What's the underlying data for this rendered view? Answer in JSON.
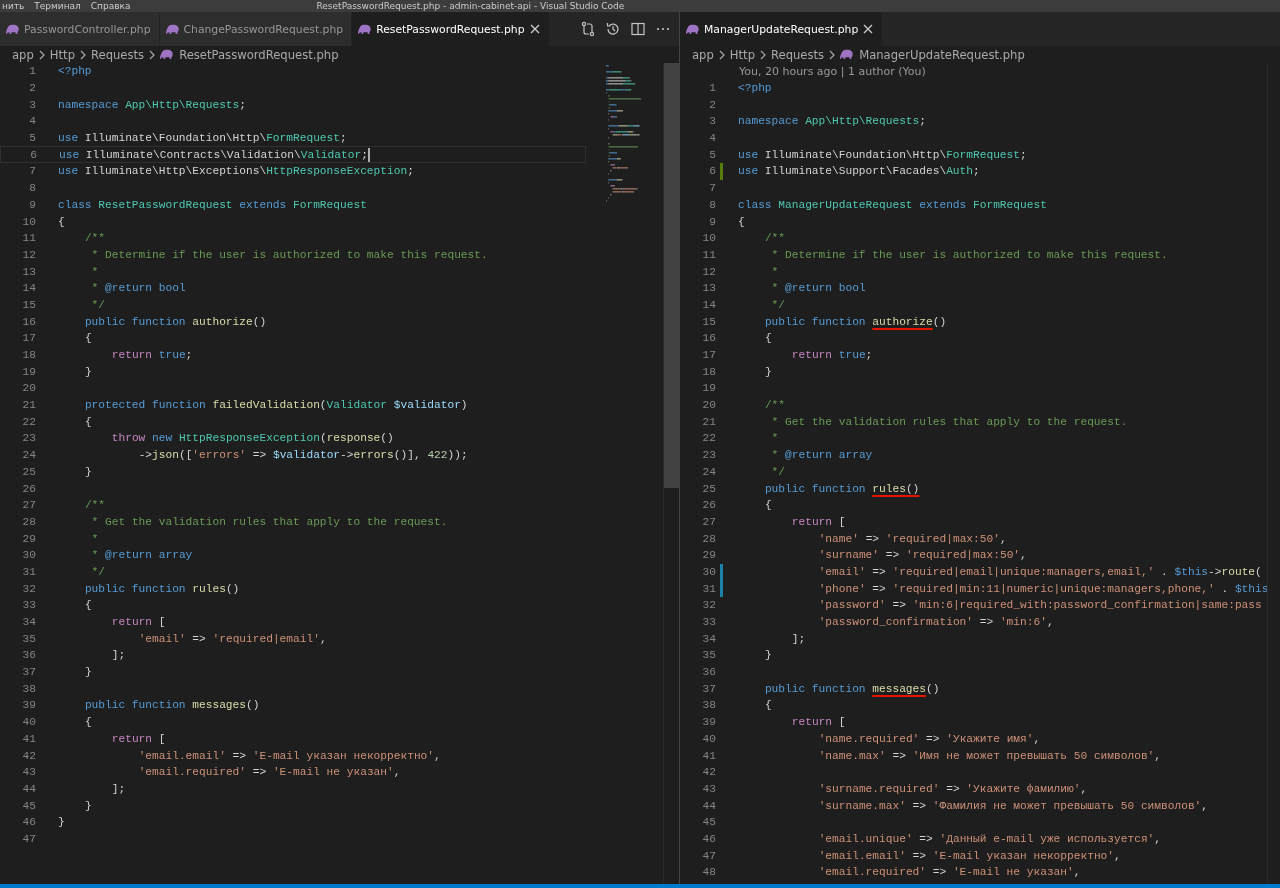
{
  "title_bar": {
    "menu": [
      "нить",
      "Терминал",
      "Справка"
    ],
    "title": "ResetPasswordRequest.php - admin-cabinet-api - Visual Studio Code"
  },
  "editors": [
    {
      "toolbar": true,
      "minimap": true,
      "tabs": [
        {
          "label": "PasswordController.php",
          "selected": false
        },
        {
          "label": "ChangePasswordRequest.php",
          "selected": false
        },
        {
          "label": "ResetPasswordRequest.php",
          "selected": true
        }
      ],
      "breadcrumbs": [
        "app",
        "Http",
        "Requests",
        "ResetPasswordRequest.php"
      ],
      "lines": [
        {
          "n": "1",
          "tokens": [
            {
              "kind": "kw",
              "text": "<?php"
            }
          ]
        },
        {
          "n": "2"
        },
        {
          "n": "3",
          "tokens": [
            {
              "kind": "kw",
              "text": "namespace "
            },
            {
              "kind": "cls",
              "text": "App\\Http\\Requests"
            },
            {
              "kind": "p",
              "text": ";"
            }
          ]
        },
        {
          "n": "4"
        },
        {
          "n": "5",
          "tokens": [
            {
              "kind": "kw",
              "text": "use "
            },
            {
              "kind": "p",
              "text": "Illuminate\\Foundation\\Http\\"
            },
            {
              "kind": "cls",
              "text": "FormRequest"
            },
            {
              "kind": "p",
              "text": ";"
            }
          ]
        },
        {
          "n": "6",
          "current": true,
          "tokens": [
            {
              "kind": "kw",
              "text": "use "
            },
            {
              "kind": "p",
              "text": "Illuminate\\Contracts\\Validation\\"
            },
            {
              "kind": "cls",
              "text": "Validator"
            },
            {
              "kind": "p",
              "text": ";"
            }
          ]
        },
        {
          "n": "7",
          "tokens": [
            {
              "kind": "kw",
              "text": "use "
            },
            {
              "kind": "p",
              "text": "Illuminate\\Http\\Exceptions\\"
            },
            {
              "kind": "cls",
              "text": "HttpResponseException"
            },
            {
              "kind": "p",
              "text": ";"
            }
          ]
        },
        {
          "n": "8"
        },
        {
          "n": "9",
          "tokens": [
            {
              "kind": "kw",
              "text": "class "
            },
            {
              "kind": "cls",
              "text": "ResetPasswordRequest "
            },
            {
              "kind": "kw",
              "text": "extends "
            },
            {
              "kind": "cls",
              "text": "FormRequest"
            }
          ]
        },
        {
          "n": "10",
          "tokens": [
            {
              "kind": "p",
              "text": "{"
            }
          ]
        },
        {
          "n": "11",
          "tokens": [
            {
              "kind": "cm",
              "text": "    /**"
            }
          ]
        },
        {
          "n": "12",
          "tokens": [
            {
              "kind": "cm",
              "text": "     * Determine if the user is authorized to make this request."
            }
          ]
        },
        {
          "n": "13",
          "tokens": [
            {
              "kind": "cm",
              "text": "     *"
            }
          ]
        },
        {
          "n": "14",
          "tokens": [
            {
              "kind": "cm",
              "text": "     * "
            },
            {
              "kind": "doc",
              "text": "@return bool"
            }
          ]
        },
        {
          "n": "15",
          "tokens": [
            {
              "kind": "cm",
              "text": "     */"
            }
          ]
        },
        {
          "n": "16",
          "tokens": [
            {
              "kind": "kw",
              "text": "    public function "
            },
            {
              "kind": "fn",
              "text": "authorize"
            },
            {
              "kind": "p",
              "text": "()"
            }
          ]
        },
        {
          "n": "17",
          "tokens": [
            {
              "kind": "p",
              "text": "    {"
            }
          ]
        },
        {
          "n": "18",
          "tokens": [
            {
              "kind": "ctl",
              "text": "        return "
            },
            {
              "kind": "kw",
              "text": "true"
            },
            {
              "kind": "p",
              "text": ";"
            }
          ]
        },
        {
          "n": "19",
          "tokens": [
            {
              "kind": "p",
              "text": "    }"
            }
          ]
        },
        {
          "n": "20"
        },
        {
          "n": "21",
          "tokens": [
            {
              "kind": "kw",
              "text": "    protected function "
            },
            {
              "kind": "fn",
              "text": "failedValidation"
            },
            {
              "kind": "p",
              "text": "("
            },
            {
              "kind": "cls",
              "text": "Validator "
            },
            {
              "kind": "var",
              "text": "$validator"
            },
            {
              "kind": "p",
              "text": ")"
            }
          ]
        },
        {
          "n": "22",
          "tokens": [
            {
              "kind": "p",
              "text": "    {"
            }
          ]
        },
        {
          "n": "23",
          "tokens": [
            {
              "kind": "ctl",
              "text": "        throw "
            },
            {
              "kind": "kw",
              "text": "new "
            },
            {
              "kind": "cls",
              "text": "HttpResponseException"
            },
            {
              "kind": "p",
              "text": "("
            },
            {
              "kind": "fn",
              "text": "response"
            },
            {
              "kind": "p",
              "text": "()"
            }
          ]
        },
        {
          "n": "24",
          "tokens": [
            {
              "kind": "p",
              "text": "            ->"
            },
            {
              "kind": "fn",
              "text": "json"
            },
            {
              "kind": "p",
              "text": "(["
            },
            {
              "kind": "str",
              "text": "'errors'"
            },
            {
              "kind": "p",
              "text": " => "
            },
            {
              "kind": "var",
              "text": "$validator"
            },
            {
              "kind": "p",
              "text": "->"
            },
            {
              "kind": "fn",
              "text": "errors"
            },
            {
              "kind": "p",
              "text": "()], "
            },
            {
              "kind": "num",
              "text": "422"
            },
            {
              "kind": "p",
              "text": "));"
            }
          ]
        },
        {
          "n": "25",
          "tokens": [
            {
              "kind": "p",
              "text": "    }"
            }
          ]
        },
        {
          "n": "26"
        },
        {
          "n": "27",
          "tokens": [
            {
              "kind": "cm",
              "text": "    /**"
            }
          ]
        },
        {
          "n": "28",
          "tokens": [
            {
              "kind": "cm",
              "text": "     * Get the validation rules that apply to the request."
            }
          ]
        },
        {
          "n": "29",
          "tokens": [
            {
              "kind": "cm",
              "text": "     *"
            }
          ]
        },
        {
          "n": "30",
          "tokens": [
            {
              "kind": "cm",
              "text": "     * "
            },
            {
              "kind": "doc",
              "text": "@return array"
            }
          ]
        },
        {
          "n": "31",
          "tokens": [
            {
              "kind": "cm",
              "text": "     */"
            }
          ]
        },
        {
          "n": "32",
          "tokens": [
            {
              "kind": "kw",
              "text": "    public function "
            },
            {
              "kind": "fn",
              "text": "rules"
            },
            {
              "kind": "p",
              "text": "()"
            }
          ]
        },
        {
          "n": "33",
          "tokens": [
            {
              "kind": "p",
              "text": "    {"
            }
          ]
        },
        {
          "n": "34",
          "tokens": [
            {
              "kind": "ctl",
              "text": "        return "
            },
            {
              "kind": "p",
              "text": "["
            }
          ]
        },
        {
          "n": "35",
          "tokens": [
            {
              "kind": "str",
              "text": "            'email'"
            },
            {
              "kind": "p",
              "text": " => "
            },
            {
              "kind": "str",
              "text": "'required|email'"
            },
            {
              "kind": "p",
              "text": ","
            }
          ]
        },
        {
          "n": "36",
          "tokens": [
            {
              "kind": "p",
              "text": "        ];"
            }
          ]
        },
        {
          "n": "37",
          "tokens": [
            {
              "kind": "p",
              "text": "    }"
            }
          ]
        },
        {
          "n": "38"
        },
        {
          "n": "39",
          "tokens": [
            {
              "kind": "kw",
              "text": "    public function "
            },
            {
              "kind": "fn",
              "text": "messages"
            },
            {
              "kind": "p",
              "text": "()"
            }
          ]
        },
        {
          "n": "40",
          "tokens": [
            {
              "kind": "p",
              "text": "    {"
            }
          ]
        },
        {
          "n": "41",
          "tokens": [
            {
              "kind": "ctl",
              "text": "        return "
            },
            {
              "kind": "p",
              "text": "["
            }
          ]
        },
        {
          "n": "42",
          "tokens": [
            {
              "kind": "str",
              "text": "            'email.email'"
            },
            {
              "kind": "p",
              "text": " => "
            },
            {
              "kind": "str",
              "text": "'E-mail указан некорректно'"
            },
            {
              "kind": "p",
              "text": ","
            }
          ]
        },
        {
          "n": "43",
          "tokens": [
            {
              "kind": "str",
              "text": "            'email.required'"
            },
            {
              "kind": "p",
              "text": " => "
            },
            {
              "kind": "str",
              "text": "'E-mail не указан'"
            },
            {
              "kind": "p",
              "text": ","
            }
          ]
        },
        {
          "n": "44",
          "tokens": [
            {
              "kind": "p",
              "text": "        ];"
            }
          ]
        },
        {
          "n": "45",
          "tokens": [
            {
              "kind": "p",
              "text": "    }"
            }
          ]
        },
        {
          "n": "46",
          "tokens": [
            {
              "kind": "p",
              "text": "}"
            }
          ]
        },
        {
          "n": "47"
        }
      ]
    },
    {
      "toolbar": false,
      "minimap": false,
      "tabs": [
        {
          "label": "ManagerUpdateRequest.php",
          "selected": true
        }
      ],
      "breadcrumbs": [
        "app",
        "Http",
        "Requests",
        "ManagerUpdateRequest.php"
      ],
      "codelens": "You, 20 hours ago | 1 author (You)",
      "lines": [
        {
          "n": "1",
          "tokens": [
            {
              "kind": "kw",
              "text": "<?php"
            }
          ]
        },
        {
          "n": "2"
        },
        {
          "n": "3",
          "tokens": [
            {
              "kind": "kw",
              "text": "namespace "
            },
            {
              "kind": "cls",
              "text": "App\\Http\\Requests"
            },
            {
              "kind": "p",
              "text": ";"
            }
          ]
        },
        {
          "n": "4"
        },
        {
          "n": "5",
          "tokens": [
            {
              "kind": "kw",
              "text": "use "
            },
            {
              "kind": "p",
              "text": "Illuminate\\Foundation\\Http\\"
            },
            {
              "kind": "cls",
              "text": "FormRequest"
            },
            {
              "kind": "p",
              "text": ";"
            }
          ]
        },
        {
          "n": "6",
          "color": "#587c0c",
          "tokens": [
            {
              "kind": "kw",
              "text": "use "
            },
            {
              "kind": "p",
              "text": "Illuminate\\Support\\Facades\\"
            },
            {
              "kind": "cls",
              "text": "Auth"
            },
            {
              "kind": "p",
              "text": ";"
            }
          ]
        },
        {
          "n": "7"
        },
        {
          "n": "8",
          "tokens": [
            {
              "kind": "kw",
              "text": "class "
            },
            {
              "kind": "cls",
              "text": "ManagerUpdateRequest "
            },
            {
              "kind": "kw",
              "text": "extends "
            },
            {
              "kind": "cls",
              "text": "FormRequest"
            }
          ]
        },
        {
          "n": "9",
          "tokens": [
            {
              "kind": "p",
              "text": "{"
            }
          ]
        },
        {
          "n": "10",
          "tokens": [
            {
              "kind": "cm",
              "text": "    /**"
            }
          ]
        },
        {
          "n": "11",
          "tokens": [
            {
              "kind": "cm",
              "text": "     * Determine if the user is authorized to make this request."
            }
          ]
        },
        {
          "n": "12",
          "tokens": [
            {
              "kind": "cm",
              "text": "     *"
            }
          ]
        },
        {
          "n": "13",
          "tokens": [
            {
              "kind": "cm",
              "text": "     * "
            },
            {
              "kind": "doc",
              "text": "@return bool"
            }
          ]
        },
        {
          "n": "14",
          "tokens": [
            {
              "kind": "cm",
              "text": "     */"
            }
          ]
        },
        {
          "n": "15",
          "tokens": [
            {
              "kind": "kw",
              "text": "    public function "
            },
            {
              "kind": "fn",
              "text": "authorize",
              "underline": true
            },
            {
              "kind": "p",
              "text": "()"
            }
          ]
        },
        {
          "n": "16",
          "tokens": [
            {
              "kind": "p",
              "text": "    {"
            }
          ]
        },
        {
          "n": "17",
          "tokens": [
            {
              "kind": "ctl",
              "text": "        return "
            },
            {
              "kind": "kw",
              "text": "true"
            },
            {
              "kind": "p",
              "text": ";"
            }
          ]
        },
        {
          "n": "18",
          "tokens": [
            {
              "kind": "p",
              "text": "    }"
            }
          ]
        },
        {
          "n": "19"
        },
        {
          "n": "20",
          "tokens": [
            {
              "kind": "cm",
              "text": "    /**"
            }
          ]
        },
        {
          "n": "21",
          "tokens": [
            {
              "kind": "cm",
              "text": "     * Get the validation rules that apply to the request."
            }
          ]
        },
        {
          "n": "22",
          "tokens": [
            {
              "kind": "cm",
              "text": "     *"
            }
          ]
        },
        {
          "n": "23",
          "tokens": [
            {
              "kind": "cm",
              "text": "     * "
            },
            {
              "kind": "doc",
              "text": "@return array"
            }
          ]
        },
        {
          "n": "24",
          "tokens": [
            {
              "kind": "cm",
              "text": "     */"
            }
          ]
        },
        {
          "n": "25",
          "tokens": [
            {
              "kind": "kw",
              "text": "    public function "
            },
            {
              "kind": "fn",
              "text": "rules",
              "underline": true
            },
            {
              "kind": "p",
              "text": "()",
              "underline": true
            }
          ]
        },
        {
          "n": "26",
          "tokens": [
            {
              "kind": "p",
              "text": "    {"
            }
          ]
        },
        {
          "n": "27",
          "tokens": [
            {
              "kind": "ctl",
              "text": "        return "
            },
            {
              "kind": "p",
              "text": "["
            }
          ]
        },
        {
          "n": "28",
          "tokens": [
            {
              "kind": "str",
              "text": "            'name'"
            },
            {
              "kind": "p",
              "text": " => "
            },
            {
              "kind": "str",
              "text": "'required|max:50'"
            },
            {
              "kind": "p",
              "text": ","
            }
          ]
        },
        {
          "n": "29",
          "tokens": [
            {
              "kind": "str",
              "text": "            'surname'"
            },
            {
              "kind": "p",
              "text": " => "
            },
            {
              "kind": "str",
              "text": "'required|max:50'"
            },
            {
              "kind": "p",
              "text": ","
            }
          ]
        },
        {
          "n": "30",
          "color": "#1b81a8",
          "tokens": [
            {
              "kind": "str",
              "text": "            'email'"
            },
            {
              "kind": "p",
              "text": " => "
            },
            {
              "kind": "str",
              "text": "'required|email|unique:managers,email,'"
            },
            {
              "kind": "p",
              "text": " . "
            },
            {
              "kind": "kw",
              "text": "$this"
            },
            {
              "kind": "p",
              "text": "->"
            },
            {
              "kind": "fn",
              "text": "route"
            },
            {
              "kind": "p",
              "text": "("
            }
          ]
        },
        {
          "n": "31",
          "color": "#1b81a8",
          "tokens": [
            {
              "kind": "str",
              "text": "            'phone'"
            },
            {
              "kind": "p",
              "text": " => "
            },
            {
              "kind": "str",
              "text": "'required|min:11|numeric|unique:managers,phone,'"
            },
            {
              "kind": "p",
              "text": " . "
            },
            {
              "kind": "kw",
              "text": "$this"
            }
          ]
        },
        {
          "n": "32",
          "tokens": [
            {
              "kind": "str",
              "text": "            'password'"
            },
            {
              "kind": "p",
              "text": " => "
            },
            {
              "kind": "str",
              "text": "'min:6|required_with:password_confirmation|same:pass"
            }
          ]
        },
        {
          "n": "33",
          "tokens": [
            {
              "kind": "str",
              "text": "            'password_confirmation'"
            },
            {
              "kind": "p",
              "text": " => "
            },
            {
              "kind": "str",
              "text": "'min:6'"
            },
            {
              "kind": "p",
              "text": ","
            }
          ]
        },
        {
          "n": "34",
          "tokens": [
            {
              "kind": "p",
              "text": "        ];"
            }
          ]
        },
        {
          "n": "35",
          "tokens": [
            {
              "kind": "p",
              "text": "    }"
            }
          ]
        },
        {
          "n": "36"
        },
        {
          "n": "37",
          "tokens": [
            {
              "kind": "kw",
              "text": "    public function "
            },
            {
              "kind": "fn",
              "text": "messages",
              "underline": true
            },
            {
              "kind": "p",
              "text": "()"
            }
          ]
        },
        {
          "n": "38",
          "tokens": [
            {
              "kind": "p",
              "text": "    {"
            }
          ]
        },
        {
          "n": "39",
          "tokens": [
            {
              "kind": "ctl",
              "text": "        return "
            },
            {
              "kind": "p",
              "text": "["
            }
          ]
        },
        {
          "n": "40",
          "tokens": [
            {
              "kind": "str",
              "text": "            'name.required'"
            },
            {
              "kind": "p",
              "text": " => "
            },
            {
              "kind": "str",
              "text": "'Укажите имя'"
            },
            {
              "kind": "p",
              "text": ","
            }
          ]
        },
        {
          "n": "41",
          "tokens": [
            {
              "kind": "str",
              "text": "            'name.max'"
            },
            {
              "kind": "p",
              "text": " => "
            },
            {
              "kind": "str",
              "text": "'Имя не может превышать 50 символов'"
            },
            {
              "kind": "p",
              "text": ","
            }
          ]
        },
        {
          "n": "42"
        },
        {
          "n": "43",
          "tokens": [
            {
              "kind": "str",
              "text": "            'surname.required'"
            },
            {
              "kind": "p",
              "text": " => "
            },
            {
              "kind": "str",
              "text": "'Укажите фамилию'"
            },
            {
              "kind": "p",
              "text": ","
            }
          ]
        },
        {
          "n": "44",
          "tokens": [
            {
              "kind": "str",
              "text": "            'surname.max'"
            },
            {
              "kind": "p",
              "text": " => "
            },
            {
              "kind": "str",
              "text": "'Фамилия не может превышать 50 символов'"
            },
            {
              "kind": "p",
              "text": ","
            }
          ]
        },
        {
          "n": "45"
        },
        {
          "n": "46",
          "tokens": [
            {
              "kind": "str",
              "text": "            'email.unique'"
            },
            {
              "kind": "p",
              "text": " => "
            },
            {
              "kind": "str",
              "text": "'Данный e-mail уже используется'"
            },
            {
              "kind": "p",
              "text": ","
            }
          ]
        },
        {
          "n": "47",
          "tokens": [
            {
              "kind": "str",
              "text": "            'email.email'"
            },
            {
              "kind": "p",
              "text": " => "
            },
            {
              "kind": "str",
              "text": "'E-mail указан некорректно'"
            },
            {
              "kind": "p",
              "text": ","
            }
          ]
        },
        {
          "n": "48",
          "tokens": [
            {
              "kind": "str",
              "text": "            'email.required'"
            },
            {
              "kind": "p",
              "text": " => "
            },
            {
              "kind": "str",
              "text": "'E-mail не указан'"
            },
            {
              "kind": "p",
              "text": ","
            }
          ]
        }
      ]
    }
  ]
}
